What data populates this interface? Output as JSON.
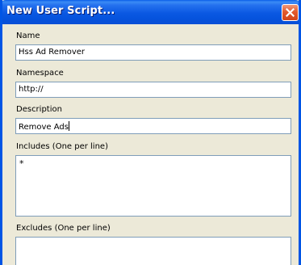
{
  "window": {
    "title": "New User Script..."
  },
  "form": {
    "name": {
      "label": "Name",
      "value": "Hss Ad Remover"
    },
    "namespace": {
      "label": "Namespace",
      "value": "http://"
    },
    "description": {
      "label": "Description",
      "value": "Remove Ads"
    },
    "includes": {
      "label": "Includes (One per line)",
      "value": "*"
    },
    "excludes": {
      "label": "Excludes (One per line)",
      "value": ""
    }
  },
  "icons": {
    "close": "close-icon"
  },
  "colors": {
    "titlebar": "#0a58e2",
    "close_button": "#e35a2e",
    "dialog_background": "#ece9d8",
    "field_border": "#7f9db9"
  }
}
